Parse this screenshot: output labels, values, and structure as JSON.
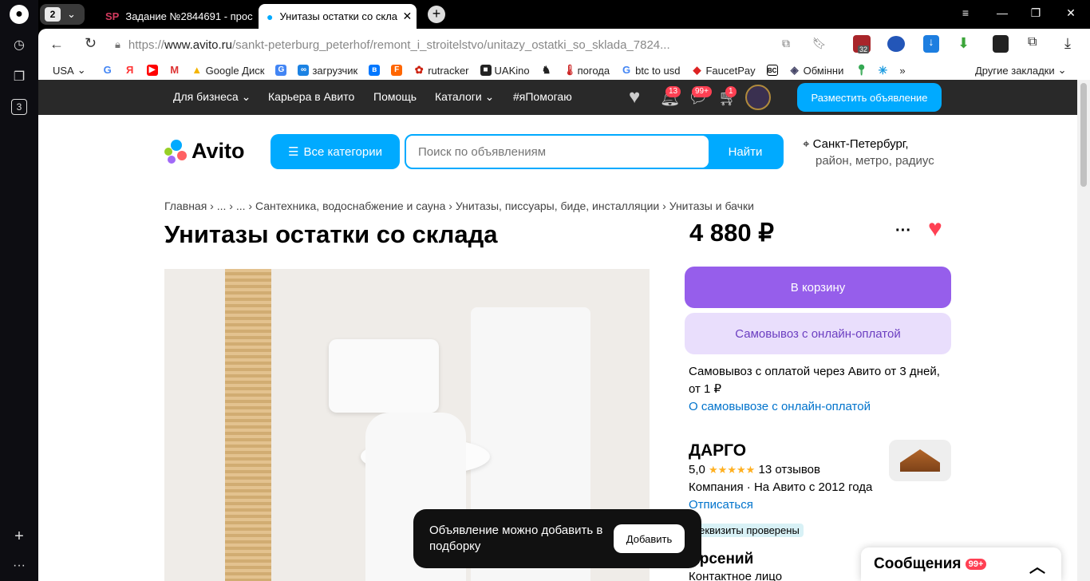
{
  "browser": {
    "tab_group_count": "2",
    "tabs": [
      {
        "favicon": "SP",
        "label": "Задание №2844691 - прос"
      },
      {
        "label": "Унитазы остатки со скла"
      }
    ],
    "address": {
      "scheme": "https://",
      "host": "www.avito.ru",
      "path": "/sankt-peterburg_peterhof/remont_i_stroitelstvo/unitazy_ostatki_so_sklada_7824..."
    },
    "ext_badge": "32",
    "rail_counter": "3",
    "bookmarks": [
      "USA",
      "Google Диск",
      "загрузчик",
      "rutracker",
      "UAKino",
      "погода",
      "btc to usd",
      "FaucetPay",
      "Обмінни"
    ],
    "bookmarks_other": "Другие закладки"
  },
  "avito": {
    "nav": [
      "Для бизнеса",
      "Карьера в Авито",
      "Помощь",
      "Каталоги",
      "#яПомогаю"
    ],
    "badges": {
      "notifications": "13",
      "messages": "99+",
      "cart": "1"
    },
    "post_button": "Разместить объявление",
    "logo_text": "Avito",
    "categories_button": "Все категории",
    "search_placeholder": "Поиск по объявлениям",
    "search_button": "Найти",
    "location_city": "Санкт-Петербург,",
    "location_hint": "район, метро, радиус",
    "breadcrumbs": [
      "Главная",
      "...",
      "...",
      "Сантехника, водоснабжение и сауна",
      "Унитазы, писсуары, биде, инсталляции",
      "Унитазы и бачки"
    ],
    "title": "Унитазы остатки со склада",
    "price": "4 880 ₽",
    "more_icon": "···",
    "cart_button": "В корзину",
    "pickup_button": "Самовывоз с онлайн-оплатой",
    "pickup_text": "Самовывоз с оплатой через Авито от 3 дней, от 1 ₽",
    "pickup_link": "О самовывозе с онлайн-оплатой",
    "seller": {
      "name": "ДАРГО",
      "rating": "5,0",
      "stars": "★★★★★",
      "reviews": "13 отзывов",
      "info": "Компания · На Авито с 2012 года",
      "unsubscribe": "Отписаться",
      "verified": "Реквизиты проверены",
      "contact_name": "Арсений",
      "contact_role": "Контактное лицо"
    },
    "toast": {
      "text": "Объявление можно добавить в подборку",
      "button": "Добавить"
    },
    "messages": {
      "label": "Сообщения",
      "badge": "99+"
    },
    "colors": {
      "accent": "#00aaff",
      "purple": "#965eeb",
      "heart": "#ff4053"
    }
  }
}
